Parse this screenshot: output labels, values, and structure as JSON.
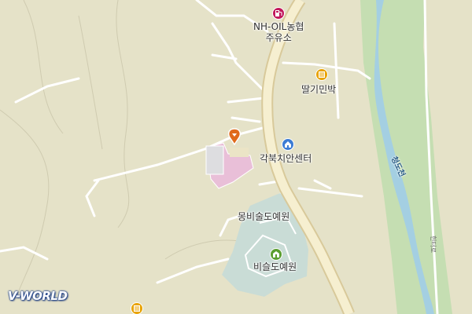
{
  "map": {
    "provider_logo": "V-WORLD",
    "colors": {
      "land": "#e5e2c8",
      "river": "#a4cfe2",
      "riverbank": "#c5deb2",
      "main_road": "#f6efd0",
      "main_road_edge": "#d8c99a",
      "minor_road": "#ffffff",
      "building": "#e9bfd8",
      "park": "#c9dcd6",
      "contour": "#c8c4a6",
      "pin": "#e06a1a"
    },
    "pois": [
      {
        "id": "gas-station",
        "label_lines": [
          "NH-OIL농협",
          "주유소"
        ],
        "icon": "gas-pump-icon",
        "icon_color": "#c2185b"
      },
      {
        "id": "pension",
        "label_lines": [
          "딸기민박"
        ],
        "icon": "lodging-icon",
        "icon_color": "#e8a200"
      },
      {
        "id": "dental",
        "label_lines": [
          "각북치안센터"
        ],
        "icon": "police-icon",
        "icon_color": "#3b7bd4"
      },
      {
        "id": "art-village",
        "label_lines": [
          "몽비술도예원"
        ],
        "icon": "",
        "icon_color": ""
      },
      {
        "id": "pottery",
        "label_lines": [
          "비슬도예원"
        ],
        "icon": "pottery-icon",
        "icon_color": "#5a9e2f"
      }
    ],
    "stream_label": "청도천",
    "road_label": "헌터로",
    "bottom_icon": "lodging-icon",
    "selected_marker": "location-pin-icon"
  }
}
